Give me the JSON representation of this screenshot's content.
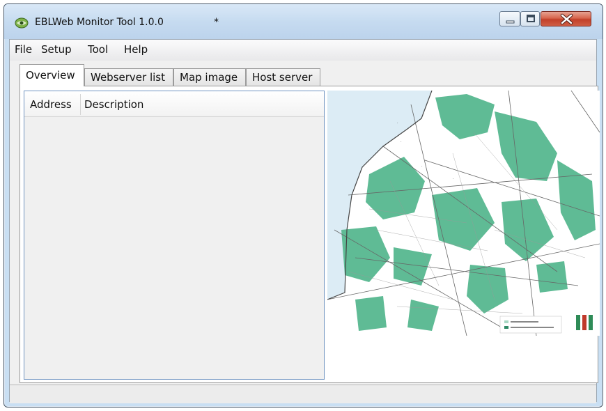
{
  "window": {
    "title": "EBLWeb Monitor Tool 1.0.0",
    "modified_marker": "*",
    "controls": {
      "minimize": "minimize",
      "maximize": "maximize",
      "close": "close"
    }
  },
  "menubar": {
    "items": [
      {
        "label": "File"
      },
      {
        "label": "Setup"
      },
      {
        "label": "Tool"
      },
      {
        "label": "Help"
      }
    ]
  },
  "tabs": [
    {
      "label": "Overview",
      "active": true
    },
    {
      "label": "Webserver list",
      "active": false
    },
    {
      "label": "Map image",
      "active": false
    },
    {
      "label": "Host server",
      "active": false
    }
  ],
  "overview": {
    "list": {
      "columns": [
        {
          "label": "Address"
        },
        {
          "label": "Description"
        }
      ],
      "rows": []
    },
    "map": {
      "description": "map-image",
      "colors": {
        "sea": "#dcecf5",
        "green_area": "#5fbb95",
        "land": "#ffffff",
        "roads": "#666666"
      }
    }
  },
  "statusbar": {
    "text": ""
  }
}
